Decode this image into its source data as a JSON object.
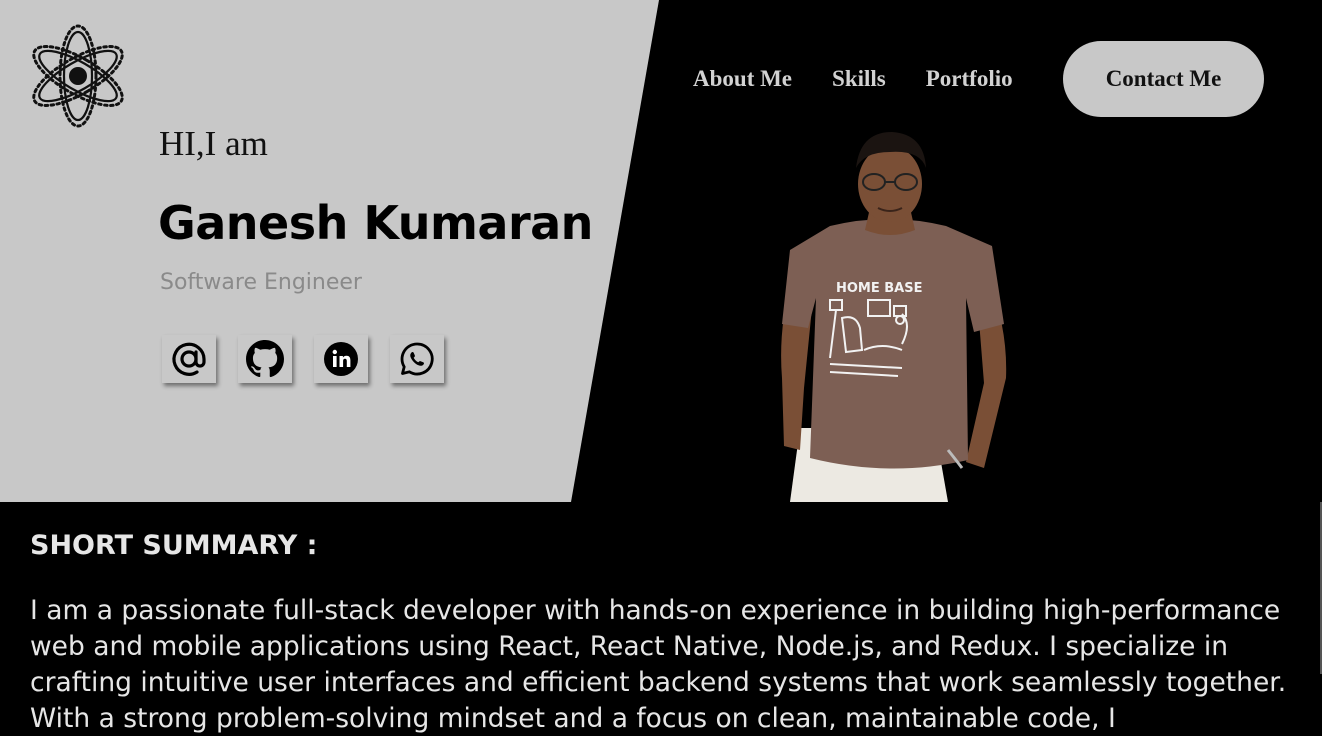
{
  "nav": {
    "about": "About Me",
    "skills": "Skills",
    "portfolio": "Portfolio",
    "contact": "Contact Me"
  },
  "logo": {
    "icon": "atom-icon"
  },
  "hero": {
    "greeting": "HI,I am",
    "name": "Ganesh Kumaran",
    "role": "Software Engineer",
    "socials": [
      {
        "icon": "at-sign-icon"
      },
      {
        "icon": "github-icon"
      },
      {
        "icon": "linkedin-icon"
      },
      {
        "icon": "whatsapp-icon"
      }
    ]
  },
  "summary": {
    "title": "SHORT SUMMARY :",
    "text": "I am a passionate full-stack developer with hands-on experience in building high-performance web and mobile applications using React, React Native, Node.js, and Redux. I specialize in crafting intuitive user interfaces and efficient backend systems that work seamlessly together. With a strong problem-solving mindset and a focus on clean, maintainable code, I"
  },
  "colors": {
    "panel": "#c8c8c8",
    "background": "#000000",
    "nav_text": "#d2d2d2",
    "muted": "#8a8a8a"
  }
}
